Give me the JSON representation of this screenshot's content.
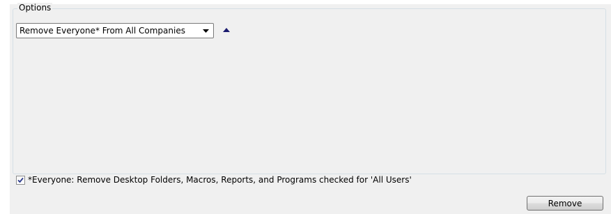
{
  "options_group": {
    "legend": "Options"
  },
  "removal_mode": {
    "selected": "Remove Everyone* From All Companies"
  },
  "icons": {
    "dropdown_arrow": "chevron-down-icon",
    "collapse": "triangle-up-icon",
    "check": "checkmark-icon"
  },
  "everyone_option": {
    "checked": true,
    "label": "*Everyone: Remove Desktop Folders, Macros, Reports, and Programs checked for 'All Users'"
  },
  "actions": {
    "remove_label": "Remove"
  },
  "colors": {
    "panel_background": "#f0f0f0",
    "page_background": "#ffffff",
    "collapse_arrow": "#1a1a6e",
    "check_mark": "#2c3a8c"
  }
}
